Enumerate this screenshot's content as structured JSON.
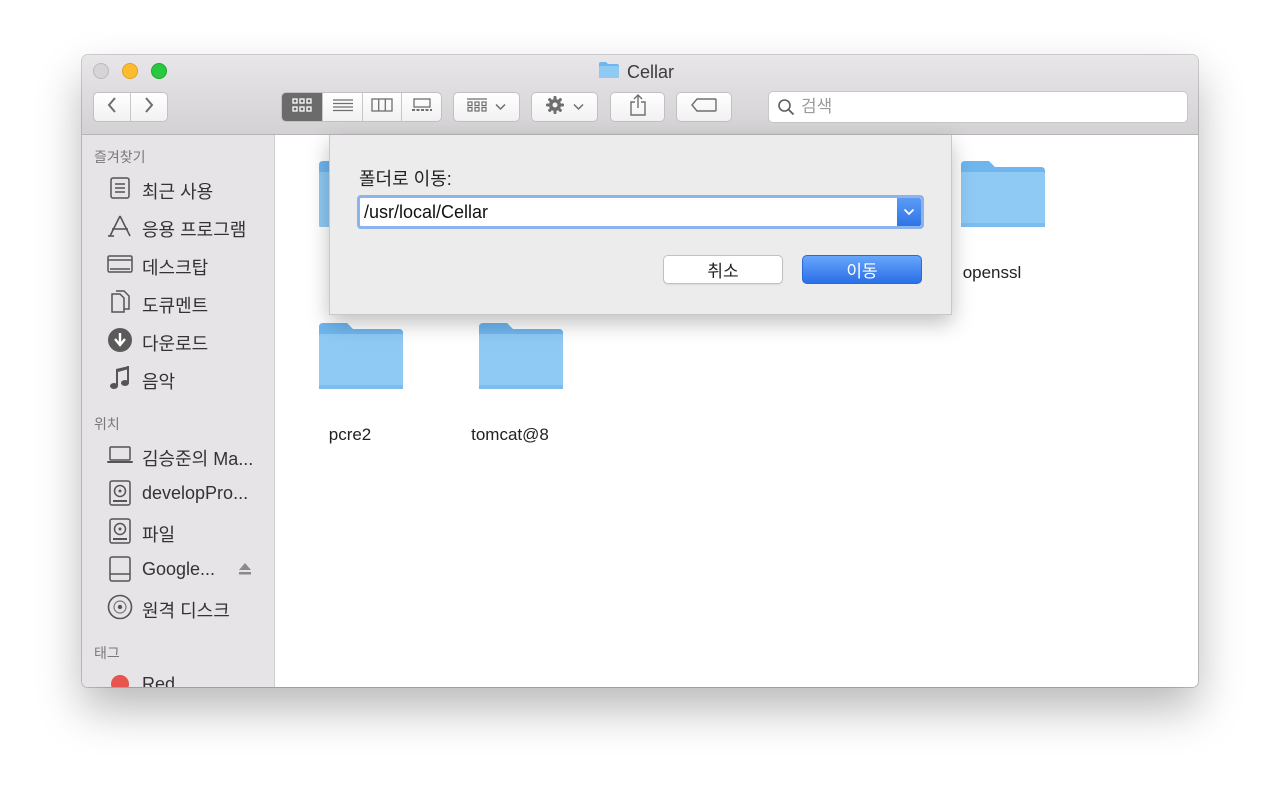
{
  "window": {
    "title": "Cellar"
  },
  "toolbar": {
    "back_icon": "chevron-left-icon",
    "forward_icon": "chevron-right-icon",
    "view_modes": [
      "icon-view",
      "list-view",
      "column-view",
      "gallery-view"
    ],
    "selected_view": "icon-view",
    "group_icon": "group-icon",
    "action_icon": "gear-icon",
    "share_icon": "share-icon",
    "tag_icon": "tag-icon",
    "search_placeholder": "검색"
  },
  "sidebar": {
    "sections": {
      "favorites": "즐겨찾기",
      "locations": "위치",
      "tags": "태그"
    },
    "favorites": [
      {
        "label": "최근 사용",
        "icon": "recents-icon"
      },
      {
        "label": "응용 프로그램",
        "icon": "applications-icon"
      },
      {
        "label": "데스크탑",
        "icon": "desktop-icon"
      },
      {
        "label": "도큐멘트",
        "icon": "documents-icon"
      },
      {
        "label": "다운로드",
        "icon": "downloads-icon"
      },
      {
        "label": "음악",
        "icon": "music-icon"
      }
    ],
    "locations": [
      {
        "label": "김승준의 Ma...",
        "icon": "laptop-icon"
      },
      {
        "label": "developPro...",
        "icon": "disk-icon"
      },
      {
        "label": "파일",
        "icon": "disk-icon"
      },
      {
        "label": "Google...",
        "icon": "drive-icon",
        "eject_icon": "eject-icon"
      },
      {
        "label": "원격 디스크",
        "icon": "optical-disc-icon"
      }
    ],
    "tags": [
      {
        "label": "Red",
        "color": "#e8544e"
      }
    ]
  },
  "content": {
    "folders": [
      "openssl",
      "pcre2",
      "tomcat@8"
    ]
  },
  "dialog": {
    "label": "폴더로 이동:",
    "path_value": "/usr/local/Cellar",
    "cancel_label": "취소",
    "go_label": "이동"
  },
  "colors": {
    "accent": "#2f74e6",
    "folder": "#8fcaf4"
  }
}
